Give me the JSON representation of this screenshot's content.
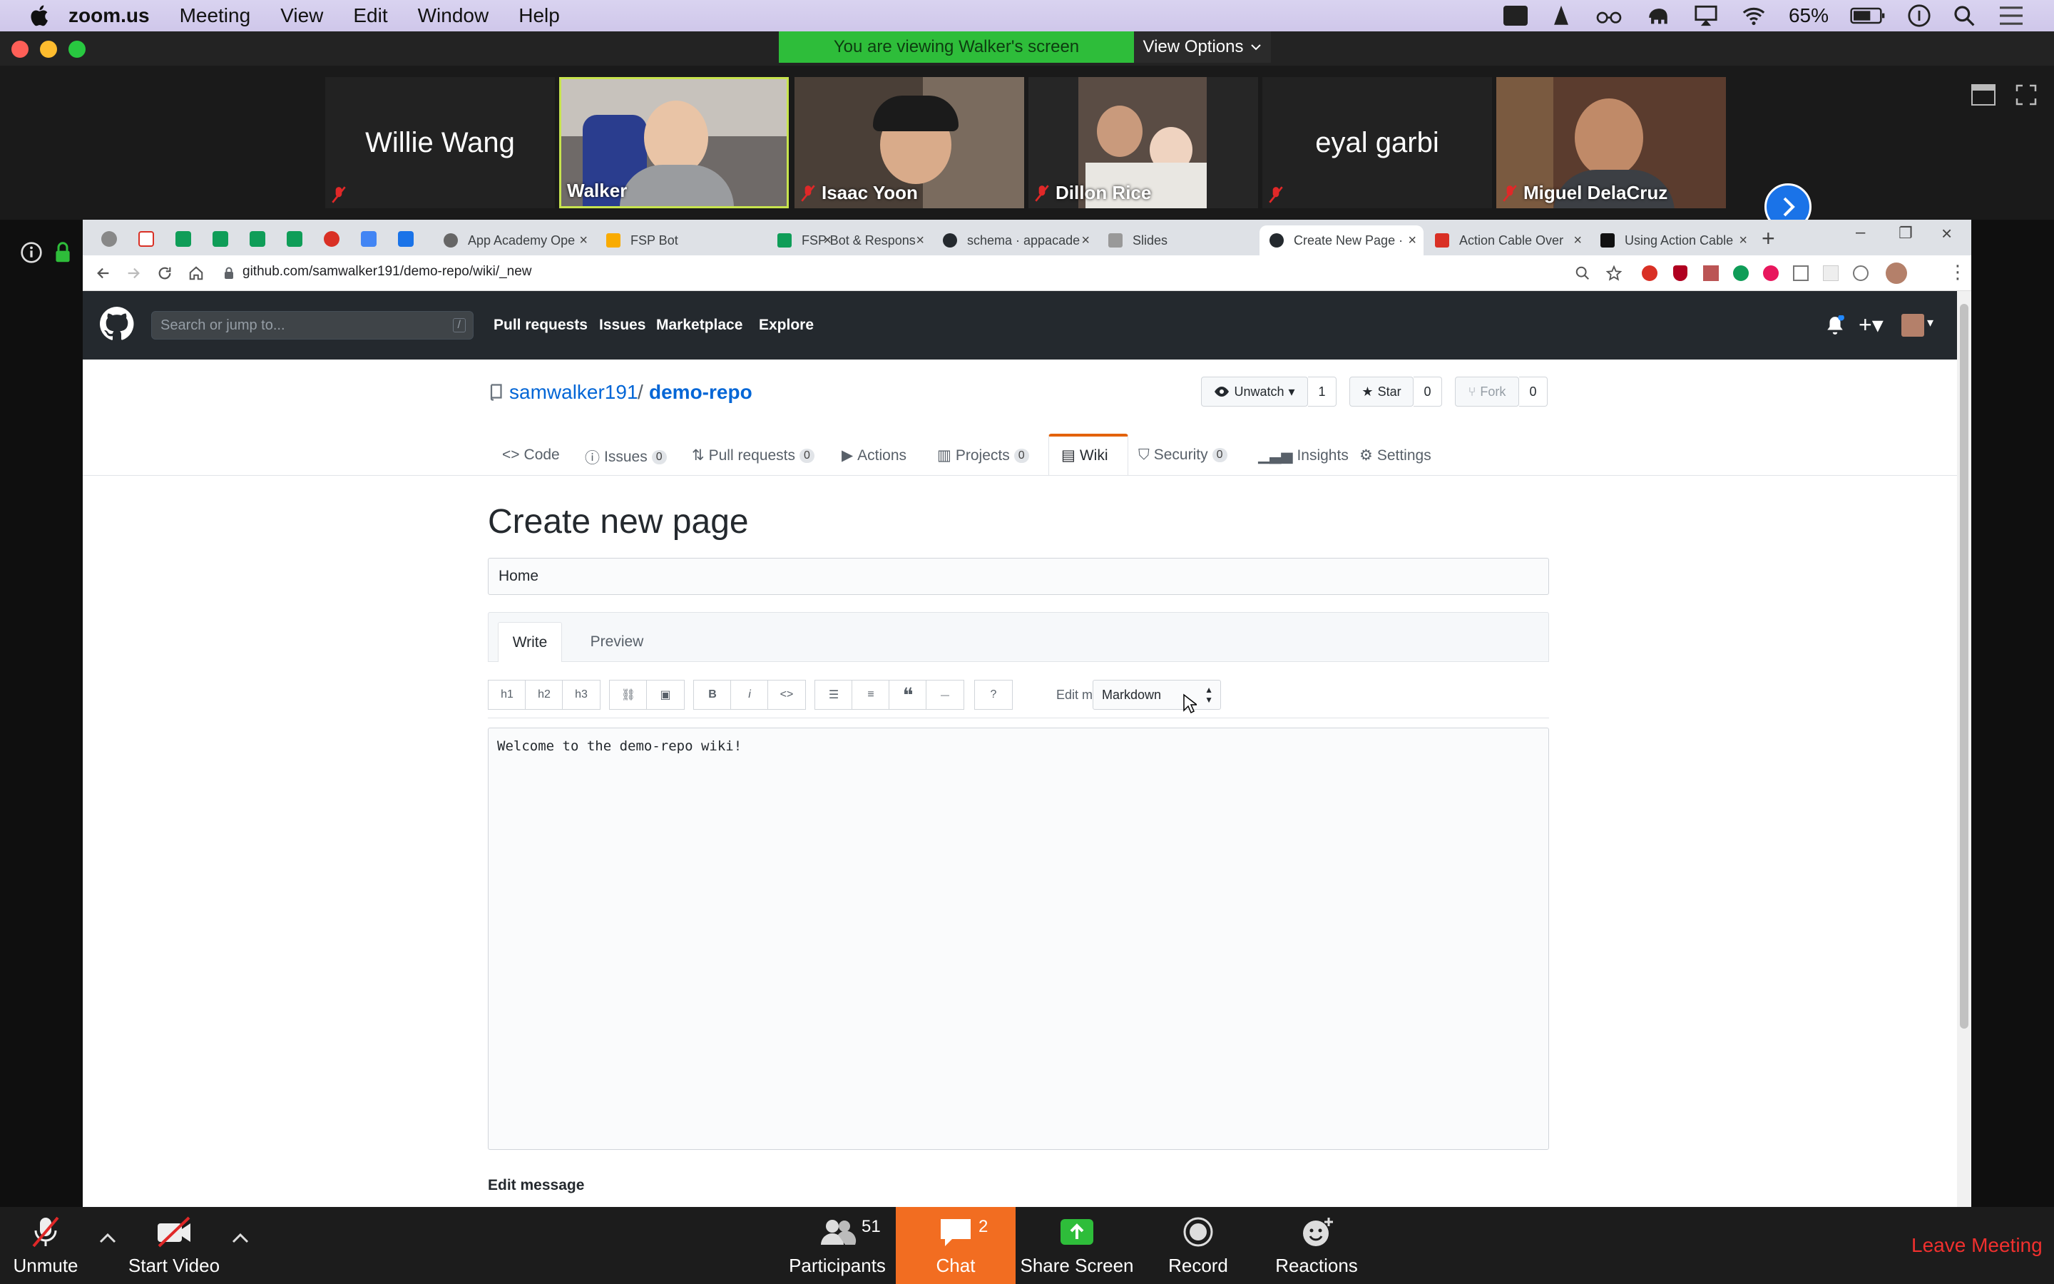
{
  "menubar": {
    "app": "zoom.us",
    "items": [
      "Meeting",
      "View",
      "Edit",
      "Window",
      "Help"
    ],
    "battery": "65%"
  },
  "zoom": {
    "viewing_banner": "You are viewing Walker's screen",
    "view_options": "View Options",
    "participants": [
      {
        "name": "Willie Wang",
        "video": false
      },
      {
        "name": "Walker",
        "video": true
      },
      {
        "name": "Isaac Yoon",
        "video": true
      },
      {
        "name": "Dillon Rice",
        "video": true
      },
      {
        "name": "eyal garbi",
        "video": false
      },
      {
        "name": "Miguel DelaCruz",
        "video": true
      }
    ],
    "toolbar": {
      "unmute": "Unmute",
      "start_video": "Start Video",
      "participants": "Participants",
      "participants_count": "51",
      "chat": "Chat",
      "chat_count": "2",
      "share_screen": "Share Screen",
      "record": "Record",
      "reactions": "Reactions",
      "leave": "Leave Meeting"
    }
  },
  "browser": {
    "tabs": [
      "App Academy Ope",
      "FSP Bot",
      "FSP Bot & Respons",
      "schema · appacade",
      "Slides",
      "Create New Page ·",
      "Action Cable Over",
      "Using Action Cable"
    ],
    "url": "github.com/samwalker191/demo-repo/wiki/_new"
  },
  "github": {
    "search_placeholder": "Search or jump to...",
    "search_key": "/",
    "nav": [
      "Pull requests",
      "Issues",
      "Marketplace",
      "Explore"
    ],
    "owner": "samwalker191",
    "separator": "/",
    "repo": "demo-repo",
    "unwatch": "Unwatch",
    "unwatch_count": "1",
    "star": "Star",
    "star_count": "0",
    "fork": "Fork",
    "fork_count": "0",
    "repo_tabs": [
      {
        "label": "Code",
        "count": ""
      },
      {
        "label": "Issues",
        "count": "0"
      },
      {
        "label": "Pull requests",
        "count": "0"
      },
      {
        "label": "Actions",
        "count": ""
      },
      {
        "label": "Projects",
        "count": "0"
      },
      {
        "label": "Wiki",
        "count": ""
      },
      {
        "label": "Security",
        "count": "0"
      },
      {
        "label": "Insights",
        "count": ""
      },
      {
        "label": "Settings",
        "count": ""
      }
    ],
    "page_heading": "Create new page",
    "title_value": "Home",
    "write_tab": "Write",
    "preview_tab": "Preview",
    "toolbar": [
      "h1",
      "h2",
      "h3",
      "B",
      "i"
    ],
    "edit_mode_label": "Edit mode:",
    "edit_mode_value": "Markdown",
    "content": "Welcome to the demo-repo wiki!",
    "edit_message_label": "Edit message"
  }
}
